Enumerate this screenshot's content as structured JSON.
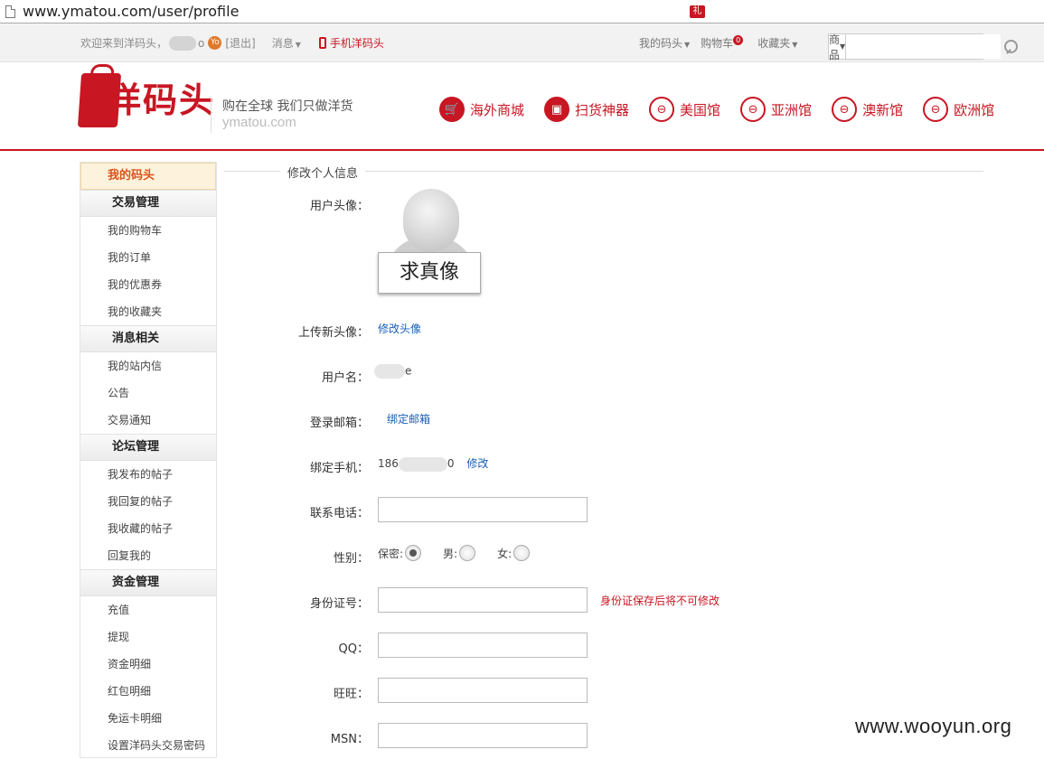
{
  "browser": {
    "url": "www.ymatou.com/user/profile"
  },
  "topbar": {
    "welcome": "欢迎来到洋码头，",
    "user_suffix": "o",
    "yo_badge": "Yo",
    "logout": "[退出]",
    "messages": "消息",
    "mobile": "手机洋码头",
    "my_ymt": "我的码头",
    "gift_badge": "礼",
    "cart": "购物车",
    "cart_count": "0",
    "favorites": "收藏夹",
    "search_category": "商品",
    "search_placeholder": ""
  },
  "header": {
    "brand": "洋码头",
    "slogan": "购在全球 我们只做洋货",
    "domain": "ymatou.com",
    "nav": [
      {
        "label": "海外商城",
        "icon": "cart-icon"
      },
      {
        "label": "扫货神器",
        "icon": "bag-icon"
      },
      {
        "label": "美国馆",
        "icon": "globe-icon"
      },
      {
        "label": "亚洲馆",
        "icon": "globe-icon"
      },
      {
        "label": "澳新馆",
        "icon": "globe-icon"
      },
      {
        "label": "欧洲馆",
        "icon": "globe-icon"
      }
    ]
  },
  "sidebar": {
    "top": "我的码头",
    "sections": [
      {
        "title": "交易管理",
        "items": [
          "我的购物车",
          "我的订单",
          "我的优惠券",
          "我的收藏夹"
        ]
      },
      {
        "title": "消息相关",
        "items": [
          "我的站内信",
          "公告",
          "交易通知"
        ]
      },
      {
        "title": "论坛管理",
        "items": [
          "我发布的帖子",
          "我回复的帖子",
          "我收藏的帖子",
          "回复我的"
        ]
      },
      {
        "title": "资金管理",
        "items": [
          "充值",
          "提现",
          "资金明细",
          "红包明细",
          "免运卡明细",
          "设置洋码头交易密码"
        ]
      }
    ]
  },
  "form": {
    "section_title": "修改个人信息",
    "avatar_label": "用户头像：",
    "avatar_card": "求真像",
    "upload_label": "上传新头像：",
    "upload_link": "修改头像",
    "username_label": "用户名：",
    "username_suffix": "e",
    "email_label": "登录邮箱：",
    "email_link": "绑定邮箱",
    "phone_label": "绑定手机：",
    "phone_prefix": "186",
    "phone_suffix": "0",
    "phone_link": "修改",
    "tel_label": "联系电话：",
    "gender_label": "性别：",
    "gender_options": [
      "保密:",
      "男:",
      "女:"
    ],
    "gender_selected": "保密",
    "id_label": "身份证号：",
    "id_warning": "身份证保存后将不可修改",
    "qq_label": "QQ：",
    "wangwang_label": "旺旺：",
    "msn_label": "MSN："
  },
  "watermark": "www.wooyun.org",
  "colors": {
    "brand_red": "#c81623",
    "link_blue": "#1a5fb4"
  }
}
